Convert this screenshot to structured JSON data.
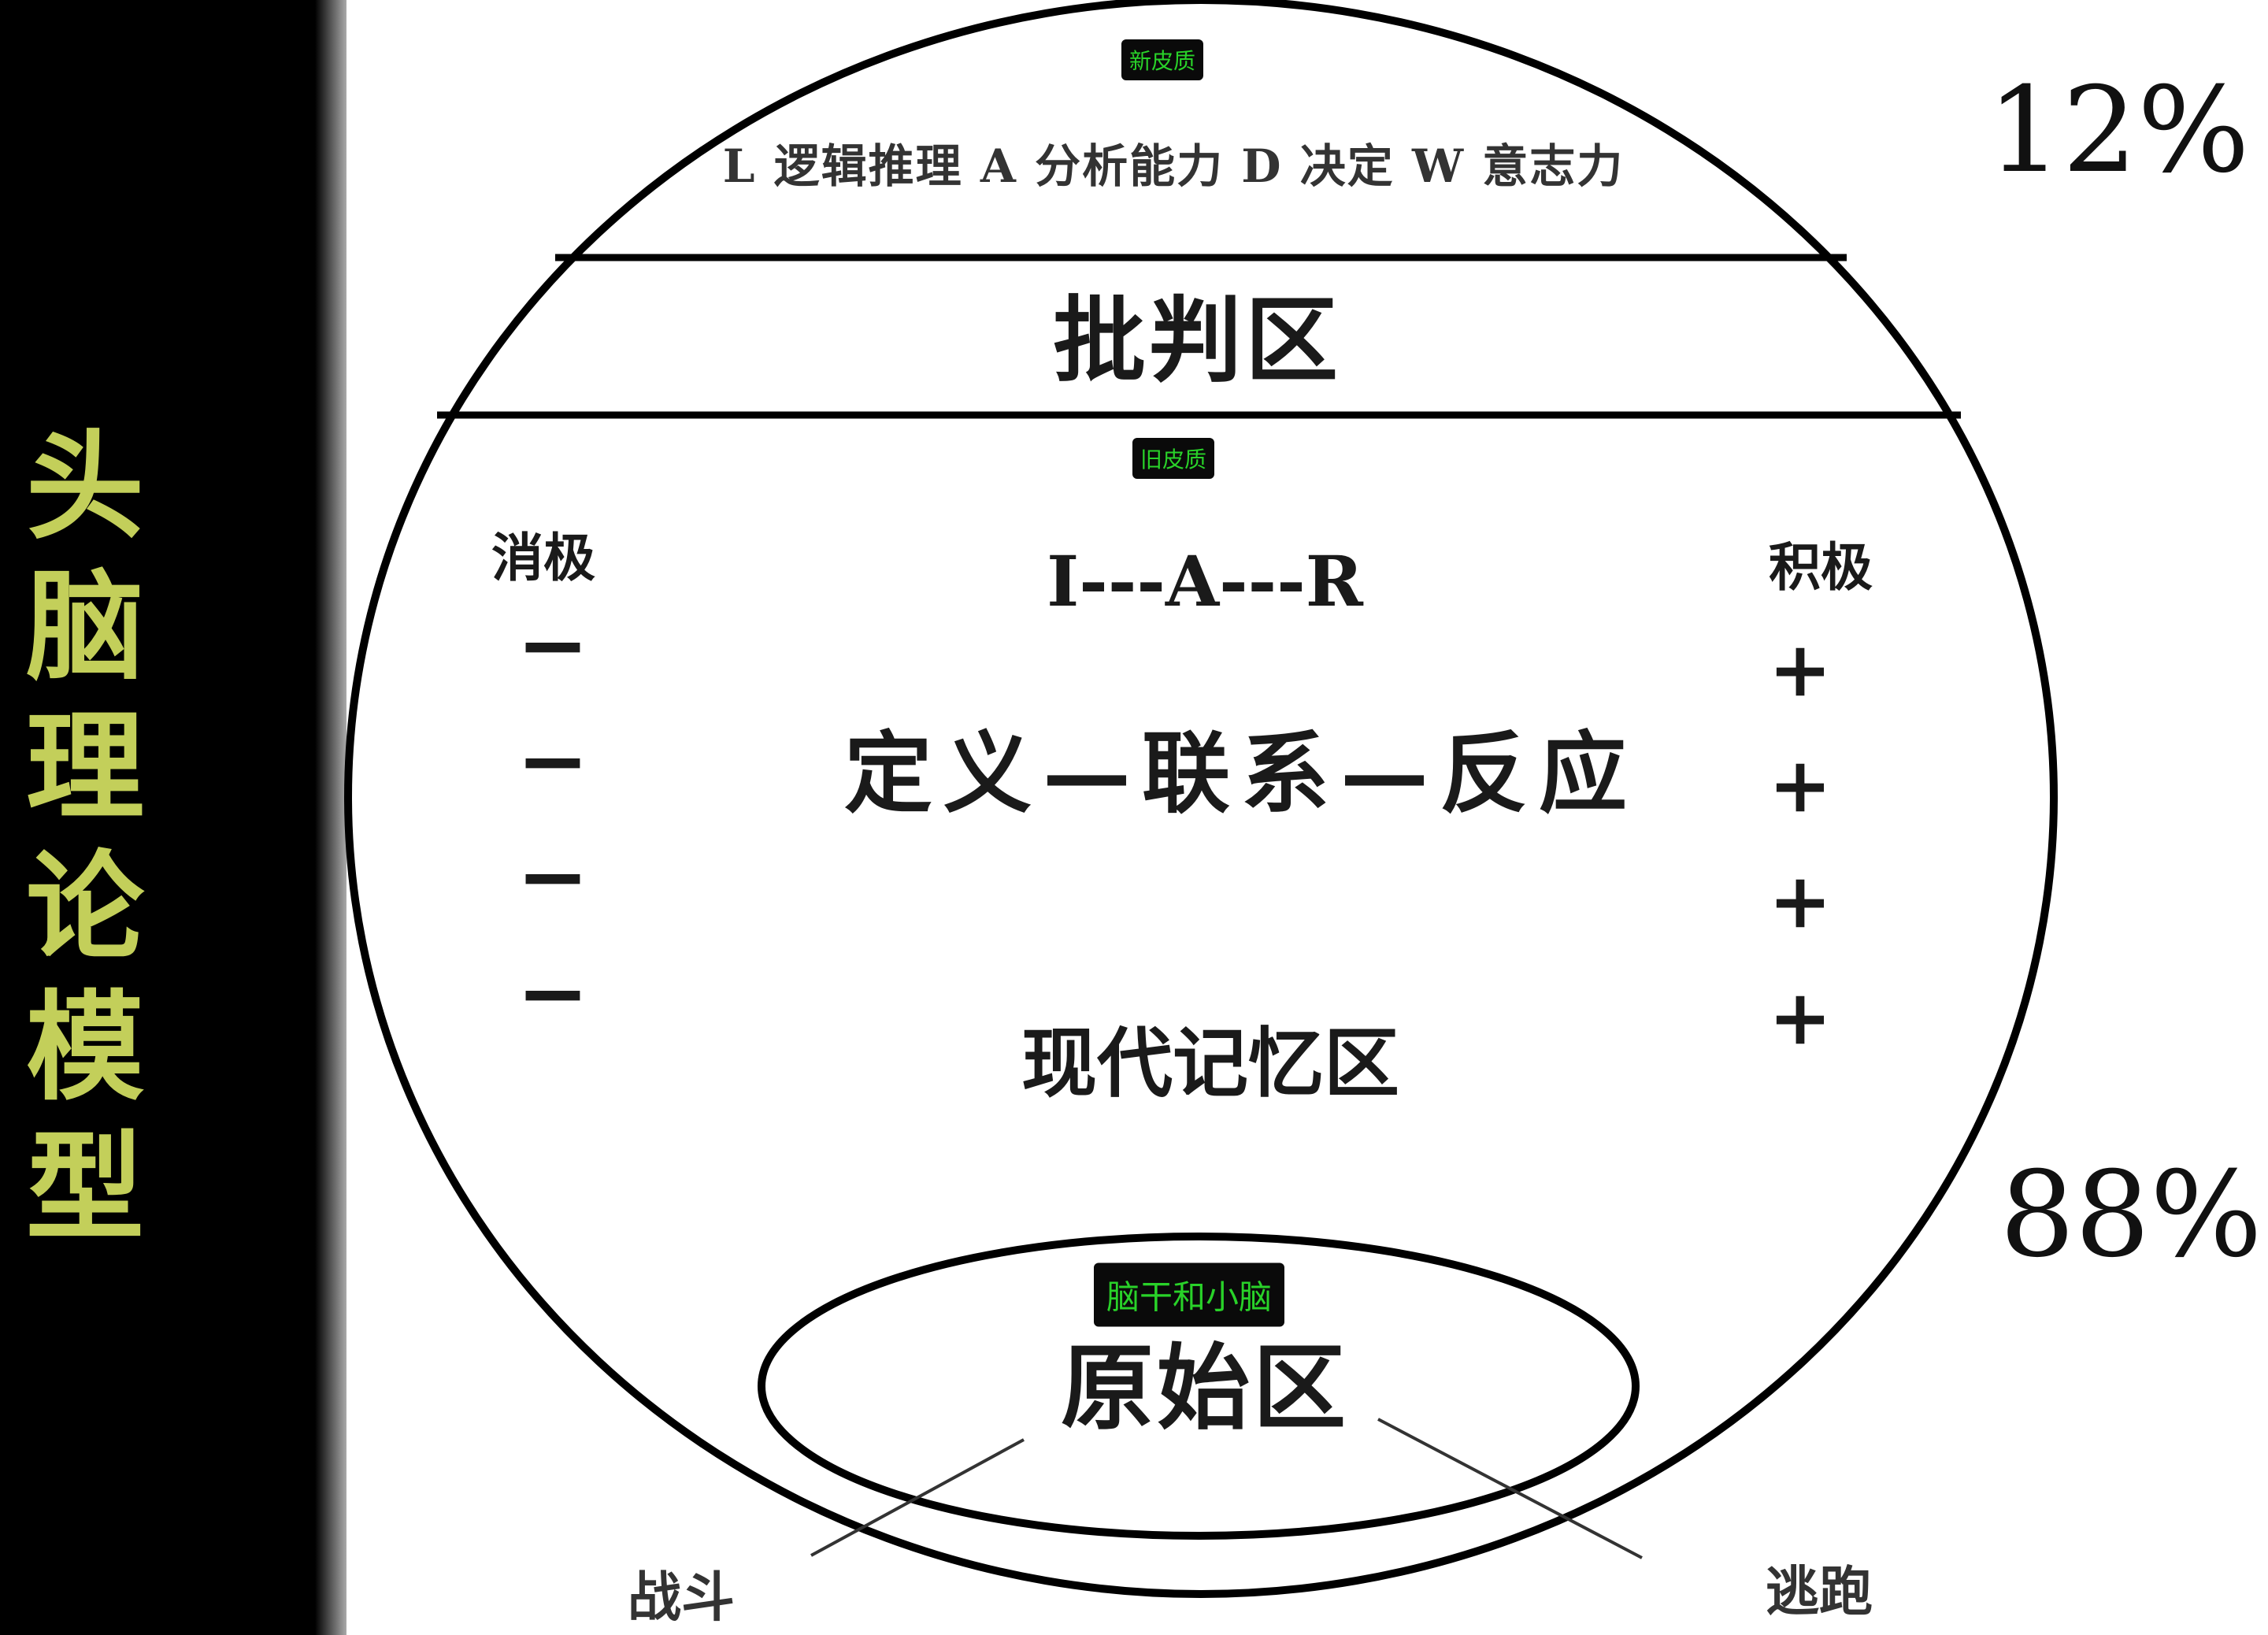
{
  "title": "头脑理论模型",
  "badges": {
    "neocortex": "新皮质",
    "old_cortex": "旧皮质",
    "brainstem": "脑干和小脑"
  },
  "top_items": "L 逻辑推理  A 分析能力  D 决定    W 意志力",
  "critical_zone": "批判区",
  "negative_label": "消极",
  "positive_label": "积极",
  "iar": "I---A---R",
  "chain": "定义—联系—反应",
  "memory_zone": "现代记忆区",
  "primitive_zone": "原始区",
  "minus_sign": "−",
  "plus_sign": "+",
  "percent_top": "12%",
  "percent_bottom": "88%",
  "fight": "战斗",
  "flee": "逃跑",
  "colors": {
    "title": "#c3cf5a",
    "badge_text": "#29d229",
    "badge_bg": "#0a0a0a",
    "ink": "#111111"
  }
}
